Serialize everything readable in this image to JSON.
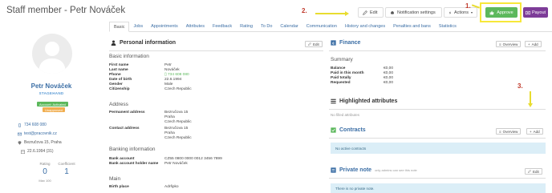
{
  "page": {
    "title": "Staff member - Petr Nováček"
  },
  "toolbar": {
    "edit": "Edit",
    "notifications": "Notification settings",
    "actions": "Actions",
    "approve": "Approve",
    "payout": "Payout"
  },
  "annotations": {
    "one": "1.",
    "two": "2.",
    "three": "3."
  },
  "tabs": [
    "Basic",
    "Jobs",
    "Appointments",
    "Attributes",
    "Feedback",
    "Rating",
    "To Do",
    "Calendar",
    "Communication",
    "History and changes",
    "Penalties and bans",
    "Statistics"
  ],
  "profile": {
    "name": "Petr Nováček",
    "role": "STAGEHAND",
    "badge_activated": "Account: Activated",
    "badge_unapproved": "Unapproved",
    "phone": "734 608 080",
    "email": "test@pracovnik.cz",
    "address": "Bezručova 15, Praha",
    "dob": "22.6.1994 (31)",
    "rating_label": "Rating",
    "rating_value": "0",
    "rating_max": "Max 100",
    "coef_label": "Coefficient",
    "coef_value": "1"
  },
  "personal": {
    "title": "Personal information",
    "edit": "Edit",
    "basic_title": "Basic information",
    "basic_keys": [
      "First name",
      "Last name",
      "Phone",
      "Date of birth",
      "Gender",
      "Citizenship"
    ],
    "basic_vals": [
      "Petr",
      "Nováček",
      "734 608 080",
      "22.6.1994",
      "Male",
      "Czech Republic"
    ],
    "address_title": "Address",
    "perm_key": "Permanent address",
    "perm_lines": [
      "Bezručova 15",
      "Praha",
      "Czech Republic"
    ],
    "contact_key": "Contact address",
    "contact_lines": [
      "Bezručova 15",
      "Praha",
      "Czech Republic"
    ],
    "banking_title": "Banking information",
    "bank_keys": [
      "Bank account",
      "Bank account holder name"
    ],
    "bank_vals": [
      "CZ55 0800 0000 0012 3456 7899",
      "Petr Nováček"
    ],
    "main_title": "Main",
    "main_keys": [
      "Birth place"
    ],
    "main_vals": [
      "Adršpko"
    ]
  },
  "finance": {
    "title": "Finance",
    "overview": "Overview",
    "add": "Add",
    "summary_title": "Summary",
    "keys": [
      "Balance",
      "Paid in this month",
      "Paid totally",
      "Requested"
    ],
    "vals": [
      "€0,00",
      "€0,00",
      "€0,00",
      "€0,00"
    ]
  },
  "highlighted": {
    "title": "Highlighted attributes",
    "empty": "No filled attributes"
  },
  "contracts": {
    "title": "Contracts",
    "overview": "Overview",
    "add": "Add",
    "empty": "No active contracts"
  },
  "private_note": {
    "title": "Private note",
    "hint": "only admins can see this note",
    "edit": "Edit",
    "empty": "There is no private note."
  },
  "colors": {
    "accent": "#3b6ea5",
    "approve": "#5cb85c",
    "payout": "#7d3c98",
    "highlight": "#f7e83a",
    "annotation": "#c0392b"
  }
}
